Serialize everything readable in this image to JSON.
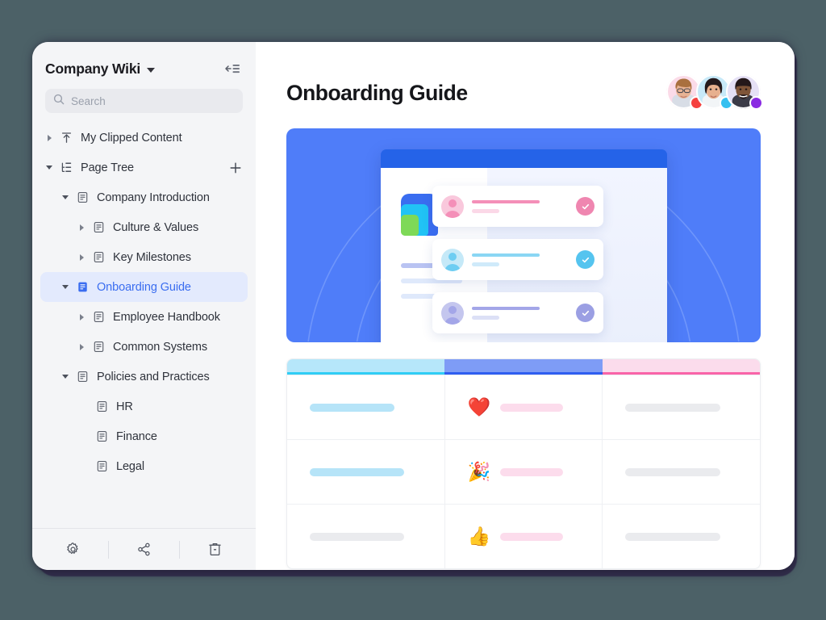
{
  "theme": {
    "page_background": "#4c6167",
    "card_background": "#ffffff",
    "sidebar_background": "#f4f5f7",
    "accent": "#3a6df0",
    "hero_blue": "#4f7df9",
    "selected_row_background": "#e3eafd",
    "shadow_plate": "#2f2b48"
  },
  "sidebar": {
    "title": "Company Wiki",
    "title_caret_icon": "chevron-down-icon",
    "collapse_icon": "collapse-sidebar-icon",
    "search": {
      "icon": "search-icon",
      "placeholder": "Search",
      "value": ""
    },
    "tree": [
      {
        "label": "My Clipped Content",
        "icon": "clip-upload-icon",
        "twisty": "right",
        "indent": 0,
        "selected": false
      },
      {
        "label": "Page Tree",
        "icon": "page-tree-icon",
        "twisty": "down",
        "indent": 0,
        "selected": false,
        "action_icon": "plus-icon"
      },
      {
        "label": "Company Introduction",
        "icon": "document-icon",
        "twisty": "down",
        "indent": 1,
        "selected": false
      },
      {
        "label": "Culture & Values",
        "icon": "document-icon",
        "twisty": "right",
        "indent": 2,
        "selected": false
      },
      {
        "label": "Key Milestones",
        "icon": "document-icon",
        "twisty": "right",
        "indent": 2,
        "selected": false
      },
      {
        "label": "Onboarding Guide",
        "icon": "document-icon-active",
        "twisty": "down",
        "indent": 1,
        "selected": true
      },
      {
        "label": "Employee Handbook",
        "icon": "document-icon",
        "twisty": "right",
        "indent": 2,
        "selected": false
      },
      {
        "label": "Common Systems",
        "icon": "document-icon",
        "twisty": "right",
        "indent": 2,
        "selected": false
      },
      {
        "label": "Policies and Practices",
        "icon": "document-icon",
        "twisty": "down",
        "indent": 1,
        "selected": false
      },
      {
        "label": "HR",
        "icon": "document-icon",
        "twisty": "none",
        "indent": 3,
        "selected": false
      },
      {
        "label": "Finance",
        "icon": "document-icon",
        "twisty": "none",
        "indent": 3,
        "selected": false
      },
      {
        "label": "Legal",
        "icon": "document-icon",
        "twisty": "none",
        "indent": 3,
        "selected": false
      }
    ],
    "footer": [
      {
        "name": "settings-button",
        "icon": "gear-icon"
      },
      {
        "name": "share-button",
        "icon": "share-icon"
      },
      {
        "name": "delete-button",
        "icon": "trash-icon"
      }
    ]
  },
  "main": {
    "page_title": "Onboarding Guide",
    "collaborators": [
      {
        "name": "avatar-1",
        "ring_color": "#fbdbe8",
        "status_color": "#f5413f",
        "skin": "#e9b89a",
        "hair": "#a9703f"
      },
      {
        "name": "avatar-2",
        "ring_color": "#c7e9f8",
        "status_color": "#35c0f0",
        "skin": "#e2ab8b",
        "hair": "#2b2225"
      },
      {
        "name": "avatar-3",
        "ring_color": "#e5e0f5",
        "status_color": "#8a2be2",
        "skin": "#7e5438",
        "hair": "#24181a"
      }
    ],
    "hero": {
      "background": "#4f7df9",
      "browser_bar_color": "#2563e8",
      "logo_layers": [
        "#3a6df0",
        "#21c3f5",
        "#7ed957"
      ],
      "placeholder_lines": [
        "#b9c3f2",
        "#dfe9fb",
        "#dfe9fb"
      ],
      "cards": [
        {
          "accent": "#f48fb8",
          "avatar_bg": "#f9c8dc",
          "line_color": "#f48fb8",
          "check": "#ef86b0"
        },
        {
          "accent": "#8ad6f4",
          "avatar_bg": "#c5e9f8",
          "line_color": "#8ad6f4",
          "check": "#55c4ef"
        },
        {
          "accent": "#a3a6e8",
          "avatar_bg": "#c4c6ee",
          "line_color": "#a3a6e8",
          "check": "#9b9fe3"
        }
      ]
    },
    "table": {
      "columns": [
        {
          "header_color": "#b6e7fa",
          "underline_color": "#30cdf5"
        },
        {
          "header_color": "#7e9cf6",
          "underline_color": "#2f5ef0"
        },
        {
          "header_color": "#fbdcec",
          "underline_color": "#f964a8"
        }
      ],
      "rows": [
        {
          "cell1": {
            "pill_color": "#b6e4f8",
            "pill_width": 105
          },
          "cell2": {
            "emoji": "❤️",
            "emoji_name": "red-heart-emoji",
            "pill_color": "#fcdcec",
            "pill_width": 78
          },
          "cell3": {
            "pill_color": "#eaebee",
            "pill_width": 118
          }
        },
        {
          "cell1": {
            "pill_color": "#b6e4f8",
            "pill_width": 117
          },
          "cell2": {
            "emoji": "🎉",
            "emoji_name": "party-popper-emoji",
            "pill_color": "#fcdcec",
            "pill_width": 78
          },
          "cell3": {
            "pill_color": "#eaebee",
            "pill_width": 118
          }
        },
        {
          "cell1": {
            "pill_color": "#eaebee",
            "pill_width": 117
          },
          "cell2": {
            "emoji": "👍",
            "emoji_name": "thumbs-up-emoji",
            "pill_color": "#fcdcec",
            "pill_width": 78
          },
          "cell3": {
            "pill_color": "#eaebee",
            "pill_width": 118
          }
        }
      ]
    }
  }
}
